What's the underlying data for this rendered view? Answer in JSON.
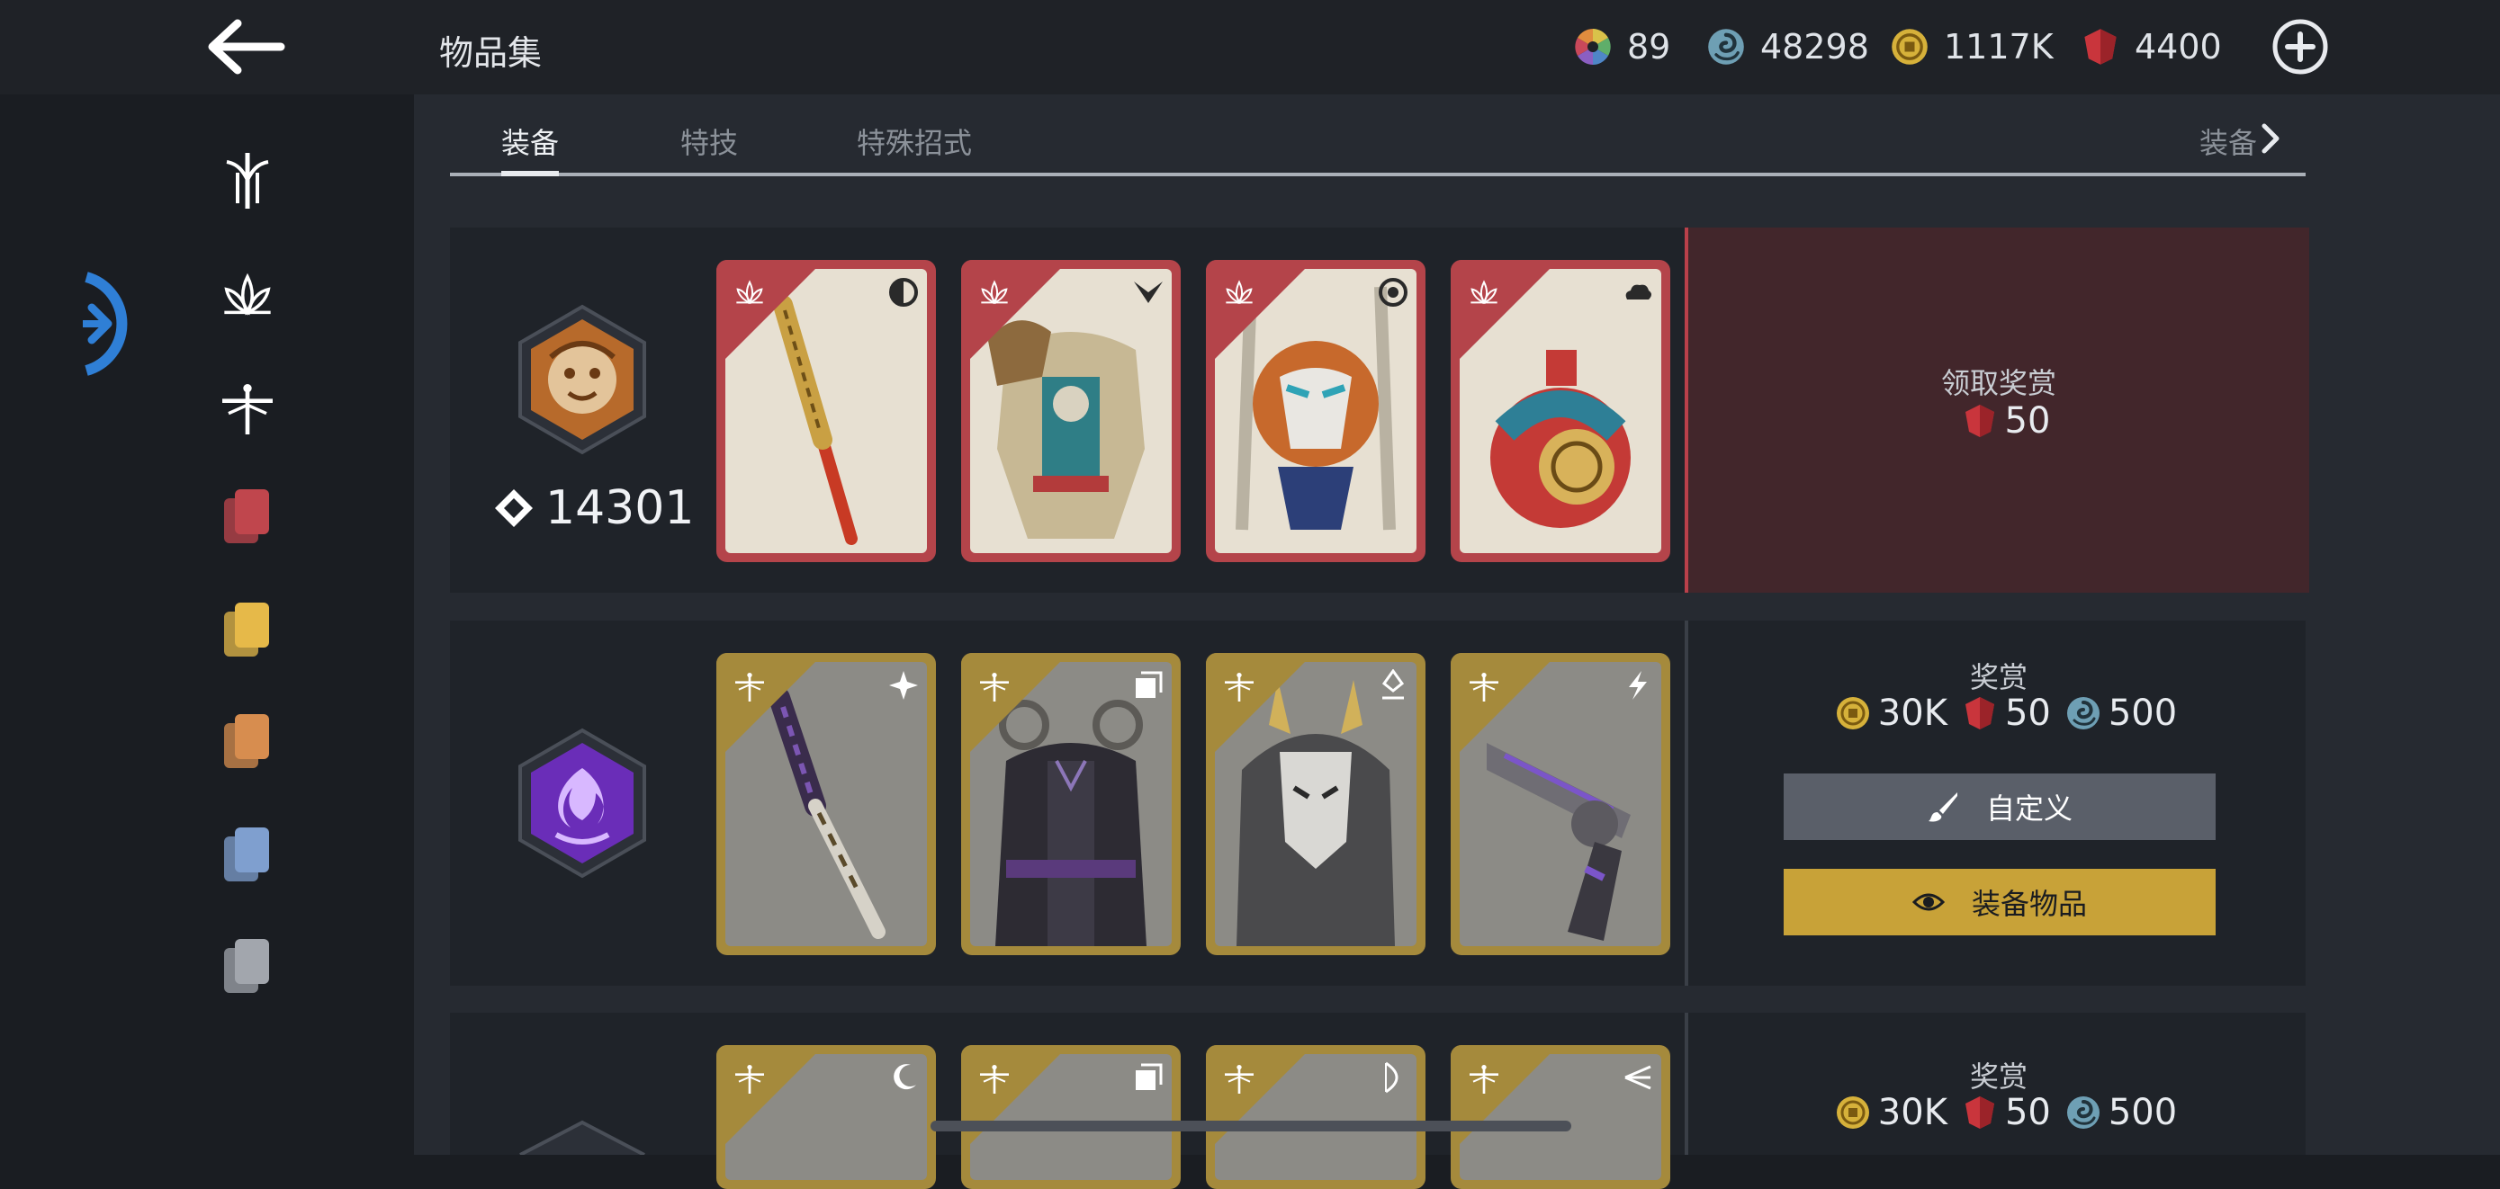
{
  "header": {
    "title": "物品集",
    "currencies": [
      {
        "name": "multicolor-orb-icon",
        "value": "89"
      },
      {
        "name": "spiral-token-icon",
        "value": "48298"
      },
      {
        "name": "gold-coin-icon",
        "value": "1117K"
      },
      {
        "name": "red-gem-icon",
        "value": "4400"
      }
    ]
  },
  "sidebar": {
    "items": [
      {
        "icon": "blade-emblem-icon"
      },
      {
        "icon": "lotus-icon"
      },
      {
        "icon": "dragonfly-icon"
      },
      {
        "icon": "red-cards-icon",
        "color": "#c0464d"
      },
      {
        "icon": "yellow-cards-icon",
        "color": "#e6b949"
      },
      {
        "icon": "orange-cards-icon",
        "color": "#d78d4f"
      },
      {
        "icon": "blue-cards-icon",
        "color": "#7f9fcf"
      },
      {
        "icon": "grey-cards-icon",
        "color": "#a2a6ad"
      }
    ]
  },
  "tabs": {
    "items": [
      "装备",
      "特技",
      "特殊招式"
    ],
    "active": "装备",
    "right_label": "装备"
  },
  "sets": [
    {
      "emblem": "lion-emblem-icon",
      "score": "14301",
      "frame_color": "#b4444a",
      "reward_label": "领取奖赏",
      "reward_values": [
        {
          "icon": "red-gem-icon",
          "value": "50"
        }
      ],
      "cards": [
        {
          "name": "golden-staff",
          "tag": "half-circle-tag-icon"
        },
        {
          "name": "monkey-armor",
          "tag": "chevron-tag-icon"
        },
        {
          "name": "monkey-mask",
          "tag": "spiral-tag-icon"
        },
        {
          "name": "gourd-flask",
          "tag": "cloud-tag-icon"
        }
      ]
    },
    {
      "emblem": "purple-flame-emblem-icon",
      "frame_color": "#a58a3c",
      "reward_label": "奖赏",
      "reward_values": [
        {
          "icon": "gold-coin-icon",
          "value": "30K"
        },
        {
          "icon": "red-gem-icon",
          "value": "50"
        },
        {
          "icon": "spiral-token-icon",
          "value": "500"
        }
      ],
      "buttons": {
        "customize": "自定义",
        "equip": "装备物品"
      },
      "cards": [
        {
          "name": "purple-katana",
          "tag": "shuriken-tag-icon"
        },
        {
          "name": "dark-robe-armor",
          "tag": "square-tag-icon"
        },
        {
          "name": "horned-mask",
          "tag": "pin-tag-icon"
        },
        {
          "name": "purple-revolver",
          "tag": "lightning-tag-icon"
        }
      ]
    },
    {
      "frame_color": "#a58a3c",
      "reward_label": "奖赏",
      "reward_values": [
        {
          "icon": "gold-coin-icon",
          "value": "30K"
        },
        {
          "icon": "red-gem-icon",
          "value": "50"
        },
        {
          "icon": "spiral-token-icon",
          "value": "500"
        }
      ],
      "cards": [
        {
          "name": "partial-card-1",
          "tag": "crescent-tag-icon"
        },
        {
          "name": "partial-card-2",
          "tag": "square-tag-icon"
        },
        {
          "name": "partial-card-3",
          "tag": "bow-tag-icon"
        },
        {
          "name": "partial-card-4",
          "tag": "claw-tag-icon"
        }
      ]
    }
  ]
}
